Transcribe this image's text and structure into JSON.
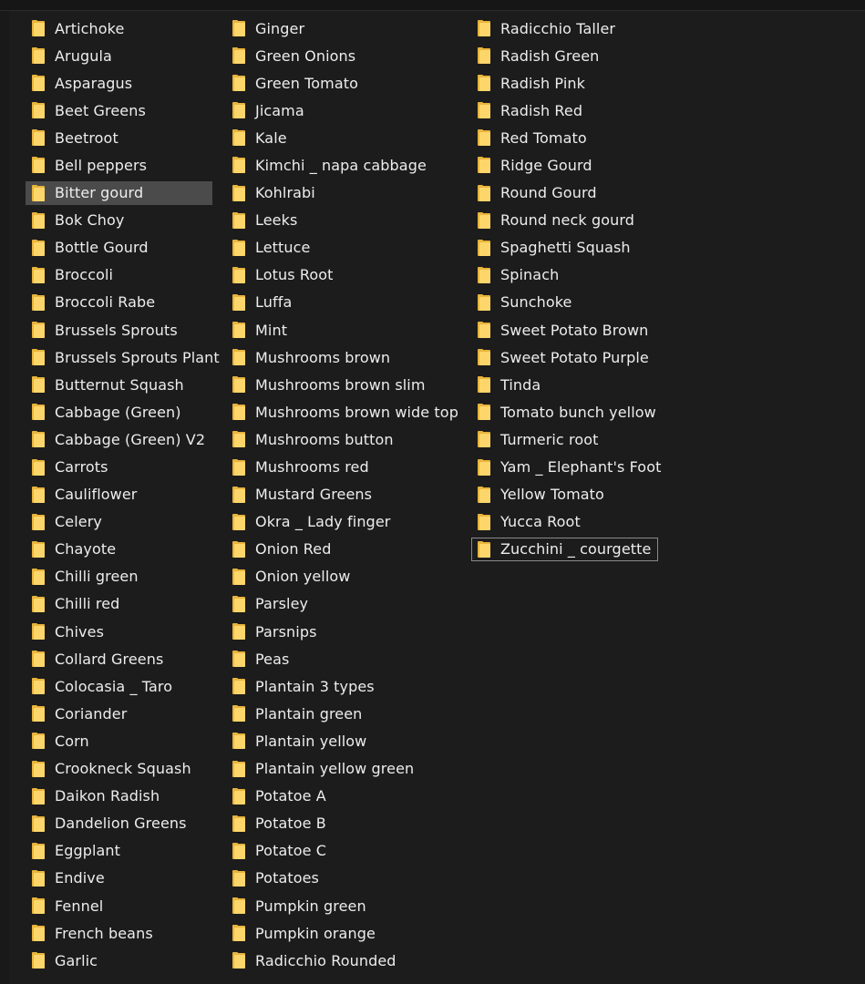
{
  "columns": [
    {
      "items": [
        {
          "label": "Artichoke"
        },
        {
          "label": "Arugula"
        },
        {
          "label": "Asparagus"
        },
        {
          "label": "Beet Greens"
        },
        {
          "label": "Beetroot"
        },
        {
          "label": "Bell peppers"
        },
        {
          "label": "Bitter gourd",
          "state": "hovered"
        },
        {
          "label": "Bok Choy"
        },
        {
          "label": "Bottle Gourd"
        },
        {
          "label": "Broccoli"
        },
        {
          "label": "Broccoli Rabe"
        },
        {
          "label": "Brussels Sprouts"
        },
        {
          "label": "Brussels Sprouts Plant"
        },
        {
          "label": "Butternut Squash"
        },
        {
          "label": "Cabbage (Green)"
        },
        {
          "label": "Cabbage (Green) V2"
        },
        {
          "label": "Carrots"
        },
        {
          "label": "Cauliflower"
        },
        {
          "label": "Celery"
        },
        {
          "label": "Chayote"
        },
        {
          "label": "Chilli green"
        },
        {
          "label": "Chilli red"
        },
        {
          "label": "Chives"
        },
        {
          "label": "Collard Greens"
        },
        {
          "label": "Colocasia _ Taro"
        },
        {
          "label": "Coriander"
        },
        {
          "label": "Corn"
        },
        {
          "label": "Crookneck Squash"
        },
        {
          "label": "Daikon Radish"
        },
        {
          "label": "Dandelion Greens"
        },
        {
          "label": "Eggplant"
        },
        {
          "label": "Endive"
        },
        {
          "label": "Fennel"
        },
        {
          "label": "French beans"
        },
        {
          "label": "Garlic"
        }
      ]
    },
    {
      "items": [
        {
          "label": "Ginger"
        },
        {
          "label": "Green Onions"
        },
        {
          "label": "Green Tomato"
        },
        {
          "label": "Jicama"
        },
        {
          "label": "Kale"
        },
        {
          "label": "Kimchi _ napa cabbage"
        },
        {
          "label": "Kohlrabi"
        },
        {
          "label": "Leeks"
        },
        {
          "label": "Lettuce"
        },
        {
          "label": "Lotus Root"
        },
        {
          "label": "Luffa"
        },
        {
          "label": "Mint"
        },
        {
          "label": "Mushrooms brown"
        },
        {
          "label": "Mushrooms brown slim"
        },
        {
          "label": "Mushrooms brown wide top"
        },
        {
          "label": "Mushrooms button"
        },
        {
          "label": "Mushrooms red"
        },
        {
          "label": "Mustard Greens"
        },
        {
          "label": "Okra _ Lady finger"
        },
        {
          "label": "Onion Red"
        },
        {
          "label": "Onion yellow"
        },
        {
          "label": "Parsley"
        },
        {
          "label": "Parsnips"
        },
        {
          "label": "Peas"
        },
        {
          "label": "Plantain 3 types"
        },
        {
          "label": "Plantain green"
        },
        {
          "label": "Plantain yellow"
        },
        {
          "label": "Plantain yellow green"
        },
        {
          "label": "Potatoe A"
        },
        {
          "label": "Potatoe B"
        },
        {
          "label": "Potatoe C"
        },
        {
          "label": "Potatoes"
        },
        {
          "label": "Pumpkin green"
        },
        {
          "label": "Pumpkin orange"
        },
        {
          "label": "Radicchio Rounded"
        }
      ]
    },
    {
      "items": [
        {
          "label": "Radicchio Taller"
        },
        {
          "label": "Radish Green"
        },
        {
          "label": "Radish Pink"
        },
        {
          "label": "Radish Red"
        },
        {
          "label": "Red Tomato"
        },
        {
          "label": "Ridge Gourd"
        },
        {
          "label": "Round Gourd"
        },
        {
          "label": "Round neck gourd"
        },
        {
          "label": "Spaghetti Squash"
        },
        {
          "label": "Spinach"
        },
        {
          "label": "Sunchoke"
        },
        {
          "label": "Sweet Potato Brown"
        },
        {
          "label": "Sweet Potato Purple"
        },
        {
          "label": "Tinda"
        },
        {
          "label": "Tomato bunch yellow"
        },
        {
          "label": "Turmeric root"
        },
        {
          "label": "Yam _ Elephant's Foot"
        },
        {
          "label": "Yellow Tomato"
        },
        {
          "label": "Yucca Root"
        },
        {
          "label": "Zucchini _ courgette",
          "state": "focused"
        }
      ]
    }
  ],
  "icon": "folder-icon",
  "colors": {
    "background": "#1c1c1c",
    "text": "#ededed",
    "hover": "#4b4b4b",
    "focus_border": "#8a8a8a",
    "folder_front": "#fcd66a",
    "folder_back": "#e8b43c"
  }
}
